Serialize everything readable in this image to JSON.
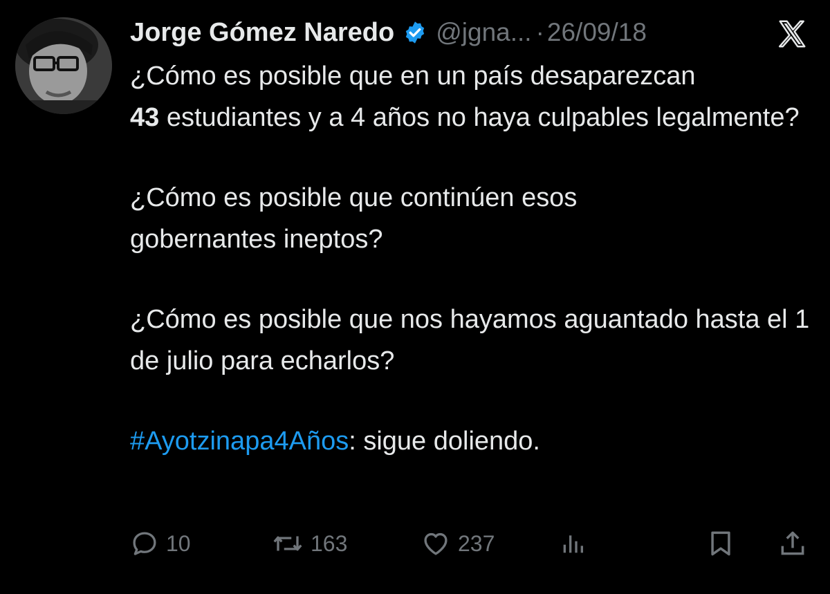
{
  "author": {
    "name": "Jorge Gómez Naredo",
    "handle": "@jgna...",
    "separator": "·",
    "date": "26/09/18"
  },
  "tweet": {
    "p1_text1": "¿Cómo es posible que en un país desaparezcan",
    "p1_bold": "43",
    "p1_text2": " estudiantes y a 4 años no haya culpables legalmente?",
    "p2": "¿Cómo es posible que continúen esos gobernantes ineptos?",
    "p3": "¿Cómo es posible que nos hayamos aguantado hasta el 1 de julio para echarlos?",
    "hashtag": "#Ayotzinapa4Años",
    "p4_rest": ": sigue doliendo."
  },
  "actions": {
    "replies": "10",
    "reposts": "163",
    "likes": "237"
  },
  "icons": {
    "verified": "verified-badge-icon",
    "platform": "x-logo-icon",
    "reply": "reply-icon",
    "repost": "repost-icon",
    "like": "heart-icon",
    "views": "views-icon",
    "bookmark": "bookmark-icon",
    "share": "share-icon"
  },
  "colors": {
    "background": "#000000",
    "text": "#e7e9ea",
    "secondary": "#71767b",
    "link": "#1d9bf0"
  }
}
